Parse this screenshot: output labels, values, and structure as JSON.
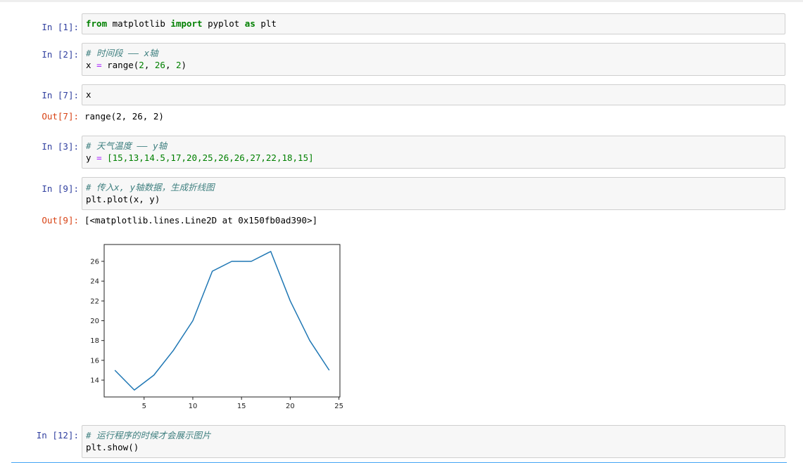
{
  "cells": [
    {
      "prompt": "In  [1]:",
      "line1": {
        "kw1": "from",
        "t1": " matplotlib ",
        "kw2": "import",
        "t2": " pyplot ",
        "kw3": "as",
        "t3": " plt"
      }
    },
    {
      "prompt": "In  [2]:",
      "comment": "# 时间段 —— x轴",
      "line2": {
        "a": "x ",
        "eq": "=",
        "b": " range(",
        "n1": "2",
        "c1": ", ",
        "n2": "26",
        "c2": ", ",
        "n3": "2",
        "end": ")"
      }
    },
    {
      "prompt": "In  [7]:",
      "code": "x",
      "out_prompt": "Out[7]:",
      "output": "range(2, 26, 2)"
    },
    {
      "prompt": "In  [3]:",
      "comment": "# 天气温度 —— y轴",
      "line2": {
        "a": "y ",
        "eq": "=",
        "b": " ",
        "list": "[15,13,14.5,17,20,25,26,26,27,22,18,15]"
      }
    },
    {
      "prompt": "In  [9]:",
      "comment": "# 传入x, y轴数据，生成折线图",
      "code": "plt.plot(x, y)",
      "out_prompt": "Out[9]:",
      "output": "[<matplotlib.lines.Line2D at 0x150fb0ad390>]"
    },
    {
      "prompt": "In  [12]:",
      "comment": "# 运行程序的时候才会展示图片",
      "code": "plt.show()"
    }
  ],
  "chart_data": {
    "type": "line",
    "x": [
      2,
      4,
      6,
      8,
      10,
      12,
      14,
      16,
      18,
      20,
      22,
      24
    ],
    "series": [
      {
        "values": [
          15,
          13,
          14.5,
          17,
          20,
          25,
          26,
          26,
          27,
          22,
          18,
          15
        ],
        "color": "#1f77b4"
      }
    ],
    "xticks": [
      5,
      10,
      15,
      20,
      25
    ],
    "yticks": [
      14,
      16,
      18,
      20,
      22,
      24,
      26
    ],
    "xlim": [
      0.9,
      25.1
    ],
    "ylim": [
      12.3,
      27.7
    ],
    "title": "",
    "xlabel": "",
    "ylabel": "",
    "grid": false
  }
}
